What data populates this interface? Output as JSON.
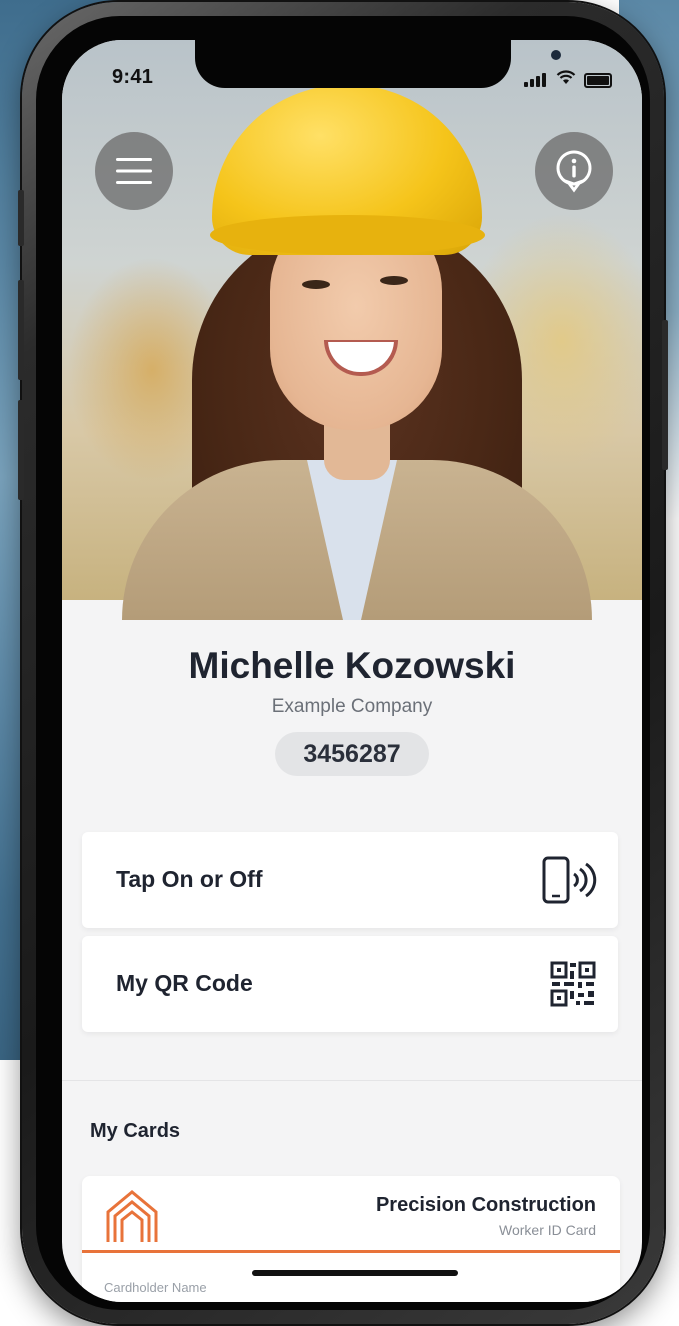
{
  "status_bar": {
    "time": "9:41"
  },
  "header": {
    "menu_icon": "hamburger-menu-icon",
    "info_icon": "info-pin-icon"
  },
  "profile": {
    "name": "Michelle Kozowski",
    "company": "Example Company",
    "id_number": "3456287"
  },
  "actions": [
    {
      "label": "Tap On or Off",
      "icon": "phone-nfc-icon"
    },
    {
      "label": "My QR Code",
      "icon": "qr-code-icon"
    }
  ],
  "cards_section": {
    "title": "My Cards",
    "cards": [
      {
        "company": "Precision Construction",
        "type": "Worker ID Card",
        "holder_label": "Cardholder Name",
        "logo": "precision-construction-logo",
        "accent": "#e8733a"
      }
    ]
  },
  "colors": {
    "hardhat": "#f5c41a",
    "accent": "#e8733a",
    "text": "#1f2430"
  }
}
